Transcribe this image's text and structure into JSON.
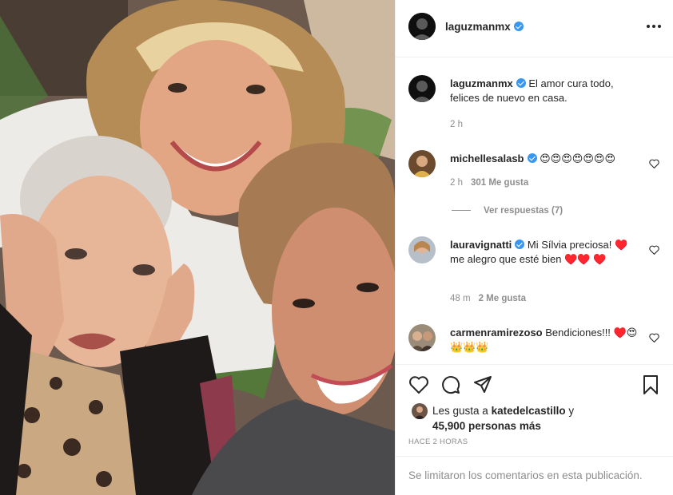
{
  "post": {
    "author": "laguzmanmx",
    "verified": true,
    "caption": "El amor cura todo, felices de nuevo en casa.",
    "caption_time": "2 h",
    "more_icon": "more-options-icon"
  },
  "comments": [
    {
      "username": "michellesalasb",
      "verified": true,
      "text": "😍😍😍😍😍😍😍",
      "time": "2 h",
      "likes": "301 Me gusta",
      "replies": "Ver respuestas (7)"
    },
    {
      "username": "lauravignatti",
      "verified": true,
      "text": "Mi Sílvia preciosa! ♥️ me alegro que esté bien ♥️♥️ ♥️",
      "time": "48 m",
      "likes": "2 Me gusta"
    },
    {
      "username": "carmenramirezoso",
      "verified": false,
      "text": "Bendiciones!!! ♥️😍👑👑👑"
    }
  ],
  "actions": {
    "like_icon": "heart-icon",
    "comment_icon": "comment-icon",
    "share_icon": "share-icon",
    "save_icon": "bookmark-icon",
    "likes_prefix": "Les gusta a",
    "likes_user": "katedelcastillo",
    "likes_connector": "y",
    "likes_count": "45,900 personas más",
    "posted_time": "HACE 2 HORAS"
  },
  "footer": {
    "text": "Se limitaron los comentarios en esta publicación."
  },
  "colors": {
    "verified": "#3897f0",
    "heart": "#d50000",
    "text": "#262626",
    "muted": "#8e8e8e",
    "divider": "#efefef"
  }
}
